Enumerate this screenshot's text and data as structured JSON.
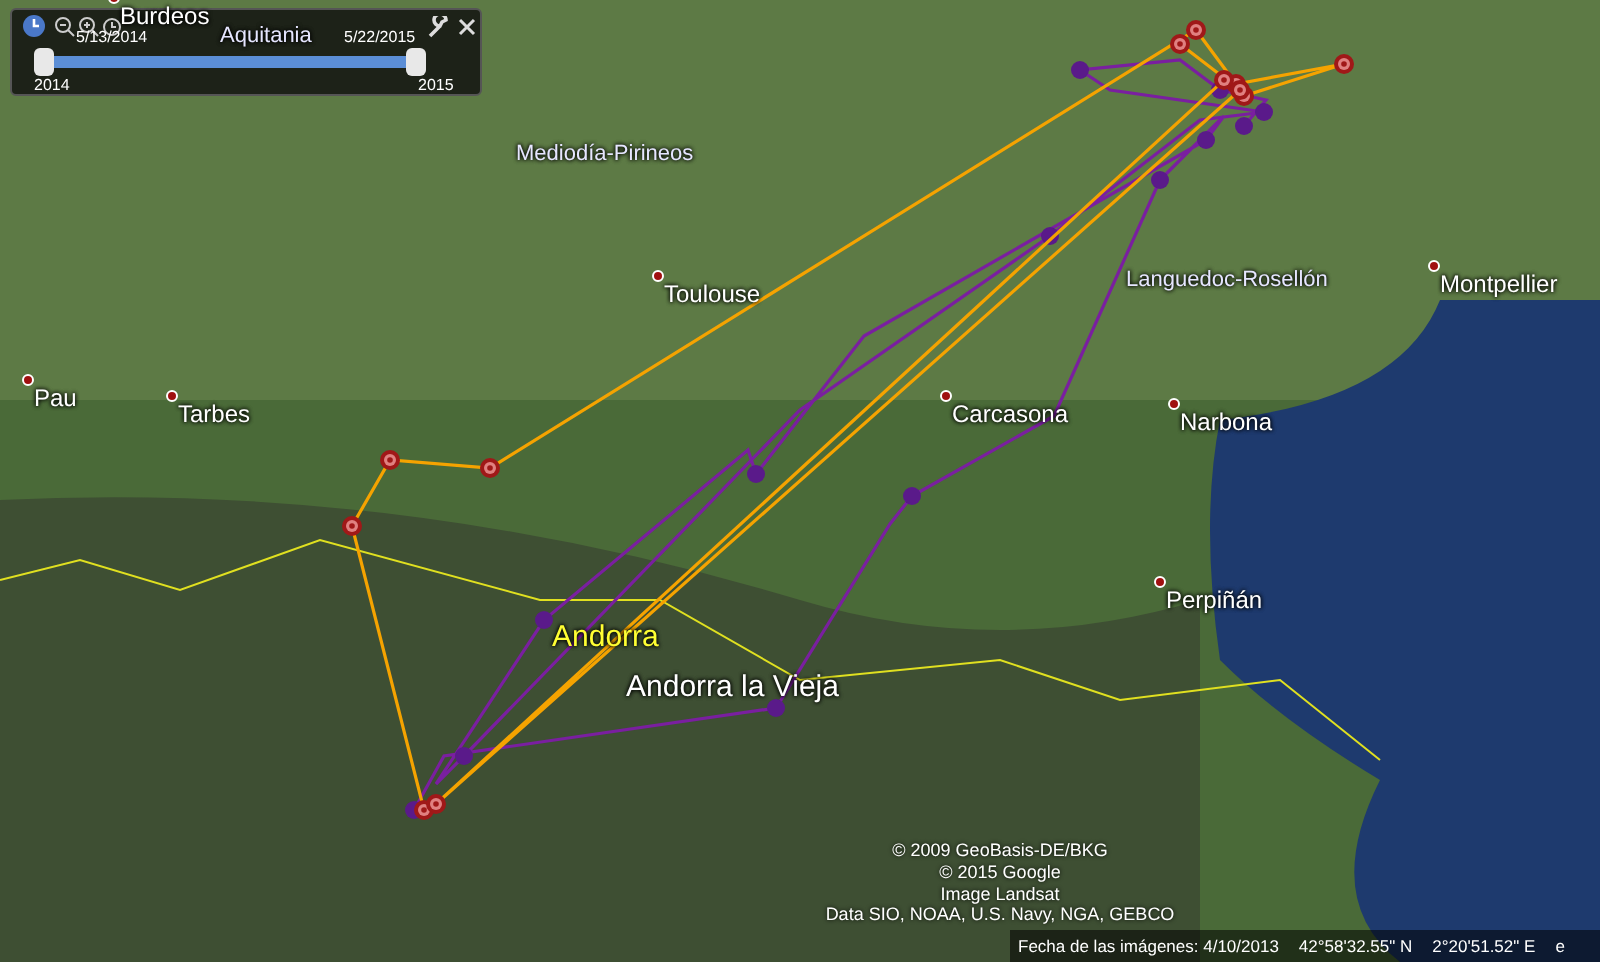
{
  "time_slider": {
    "start_date": "5/13/2014",
    "end_date": "5/22/2015",
    "start_year": "2014",
    "end_year": "2015",
    "thumbs": [
      {
        "level": 0
      },
      {
        "level": 1
      }
    ]
  },
  "map": {
    "labels": [
      {
        "text": "Burdeos",
        "kind": "city"
      },
      {
        "text": "Aquitania",
        "kind": "region"
      },
      {
        "text": "Mediodía-Pirineos",
        "kind": "region"
      },
      {
        "text": "Toulouse",
        "kind": "city"
      },
      {
        "text": "Languedoc-Rosellón",
        "kind": "region"
      },
      {
        "text": "Montpellier",
        "kind": "city"
      },
      {
        "text": "Pau",
        "kind": "city"
      },
      {
        "text": "Tarbes",
        "kind": "city"
      },
      {
        "text": "Carcasona",
        "kind": "city"
      },
      {
        "text": "Narbona",
        "kind": "city"
      },
      {
        "text": "Perpiñán",
        "kind": "city"
      },
      {
        "text": "Andorra",
        "kind": "country"
      },
      {
        "text": "Andorra la Vieja",
        "kind": "capital"
      }
    ],
    "tracks": [
      {
        "color": "#7a1fa0",
        "kind": "dots"
      },
      {
        "color": "#f5a300",
        "kind": "targets"
      }
    ],
    "attribution": [
      "© 2009 GeoBasis-DE/BKG",
      "© 2015 Google",
      "Image Landsat",
      "Data SIO, NOAA, U.S. Navy, NGA, GEBCO"
    ]
  },
  "status_bar": {
    "imagery_date": "Fecha de las imágenes: 4/10/2013",
    "latitude": "42°58'32.55\" N",
    "longitude": "2°20'51.52\" E",
    "elevation": "e"
  }
}
